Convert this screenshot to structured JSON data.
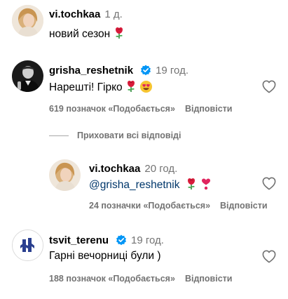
{
  "comments": [
    {
      "username": "vi.tochkaa",
      "time": "1 д.",
      "text": "новий сезон",
      "emojis": [
        "rose"
      ]
    },
    {
      "username": "grisha_reshetnik",
      "verified": true,
      "time": "19 год.",
      "text": "Нарешті! Гірко",
      "emojis": [
        "rose",
        "heart-eyes"
      ],
      "likes": "619 позначок «Подобається»",
      "reply_label": "Відповісти",
      "hide_replies_label": "Приховати всі відповіді"
    },
    {
      "username": "vi.tochkaa",
      "time": "20 год.",
      "mention": "@grisha_reshetnik",
      "emojis": [
        "rose",
        "heart-exclamation"
      ],
      "likes": "24 позначки «Подобається»",
      "reply_label": "Відповісти"
    },
    {
      "username": "tsvit_terenu",
      "verified": true,
      "time": "19 год.",
      "text": "Гарні вечорниці були )",
      "likes": "188 позначок «Подобається»",
      "reply_label": "Відповісти"
    }
  ],
  "colors": {
    "secondary_text": "#737373",
    "verified_badge": "#0095f6",
    "mention": "#00376b",
    "rose": "#d81b3a"
  }
}
